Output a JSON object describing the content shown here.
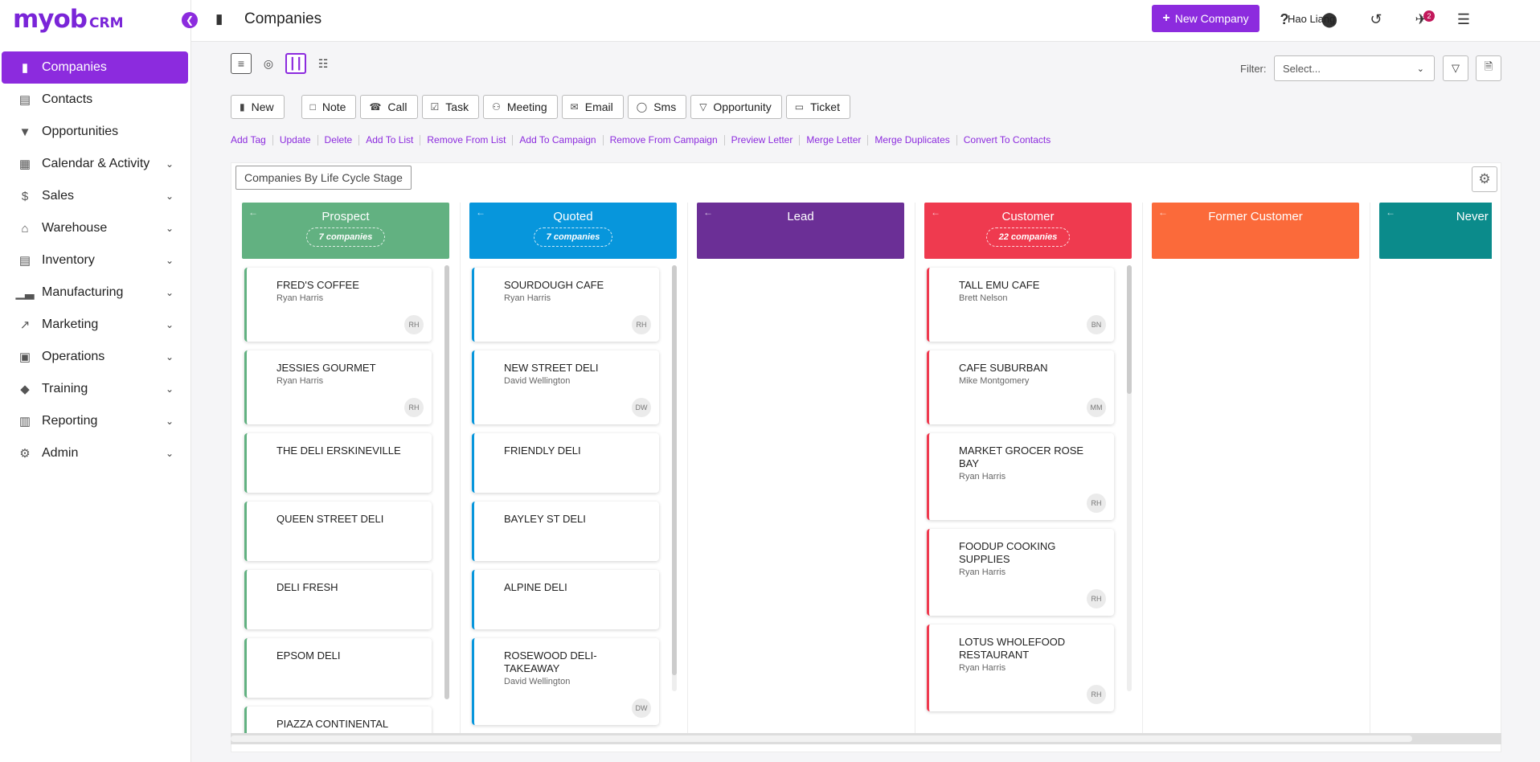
{
  "brand": {
    "logo_main": "myob",
    "logo_sub": "CRM"
  },
  "sidebar": {
    "items": [
      {
        "label": "Companies",
        "icon": "building-icon",
        "active": true
      },
      {
        "label": "Contacts",
        "icon": "contact-card-icon"
      },
      {
        "label": "Opportunities",
        "icon": "funnel-icon"
      },
      {
        "label": "Calendar & Activity",
        "icon": "calendar-icon",
        "expandable": true
      },
      {
        "label": "Sales",
        "icon": "dollar-icon",
        "expandable": true
      },
      {
        "label": "Warehouse",
        "icon": "warehouse-icon",
        "expandable": true
      },
      {
        "label": "Inventory",
        "icon": "clipboard-icon",
        "expandable": true
      },
      {
        "label": "Manufacturing",
        "icon": "factory-icon",
        "expandable": true
      },
      {
        "label": "Marketing",
        "icon": "trend-chart-icon",
        "expandable": true
      },
      {
        "label": "Operations",
        "icon": "operations-icon",
        "expandable": true
      },
      {
        "label": "Training",
        "icon": "graduation-cap-icon",
        "expandable": true
      },
      {
        "label": "Reporting",
        "icon": "report-icon",
        "expandable": true
      },
      {
        "label": "Admin",
        "icon": "gear-icon",
        "expandable": true
      }
    ]
  },
  "header": {
    "title": "Companies",
    "new_button": "New Company",
    "notification_count": "2",
    "user_name": "Hao Liang"
  },
  "filter": {
    "label": "Filter:",
    "placeholder": "Select..."
  },
  "actions": [
    "New",
    "Note",
    "Call",
    "Task",
    "Meeting",
    "Email",
    "Sms",
    "Opportunity",
    "Ticket"
  ],
  "links": [
    "Add Tag",
    "Update",
    "Delete",
    "Add To List",
    "Remove From List",
    "Add To Campaign",
    "Remove From Campaign",
    "Preview Letter",
    "Merge Letter",
    "Merge Duplicates",
    "Convert To Contacts"
  ],
  "board": {
    "title": "Companies By Life Cycle Stage",
    "columns": [
      {
        "name": "Prospect",
        "count": "7 companies",
        "color": "#62b181",
        "cards": [
          {
            "name": "FRED'S COFFEE",
            "owner": "Ryan Harris",
            "initials": "RH"
          },
          {
            "name": "JESSIES GOURMET",
            "owner": "Ryan Harris",
            "initials": "RH"
          },
          {
            "name": "THE DELI ERSKINEVILLE"
          },
          {
            "name": "QUEEN STREET DELI"
          },
          {
            "name": "DELI FRESH"
          },
          {
            "name": "EPSOM DELI"
          },
          {
            "name": "PIAZZA CONTINENTAL"
          }
        ]
      },
      {
        "name": "Quoted",
        "count": "7 companies",
        "color": "#0796dc",
        "cards": [
          {
            "name": "SOURDOUGH CAFE",
            "owner": "Ryan Harris",
            "initials": "RH"
          },
          {
            "name": "NEW STREET DELI",
            "owner": "David Wellington",
            "initials": "DW"
          },
          {
            "name": "FRIENDLY DELI"
          },
          {
            "name": "BAYLEY ST DELI"
          },
          {
            "name": "ALPINE DELI"
          },
          {
            "name": "ROSEWOOD DELI-TAKEAWAY",
            "owner": "David Wellington",
            "initials": "DW"
          }
        ]
      },
      {
        "name": "Lead",
        "count": "",
        "color": "#6b2f96",
        "cards": []
      },
      {
        "name": "Customer",
        "count": "22 companies",
        "color": "#ef3a4f",
        "cards": [
          {
            "name": "TALL EMU CAFE",
            "owner": "Brett Nelson",
            "initials": "BN"
          },
          {
            "name": "CAFE SUBURBAN",
            "owner": "Mike Montgomery",
            "initials": "MM"
          },
          {
            "name": "MARKET GROCER ROSE BAY",
            "owner": "Ryan Harris",
            "initials": "RH"
          },
          {
            "name": "FOODUP COOKING SUPPLIES",
            "owner": "Ryan Harris",
            "initials": "RH"
          },
          {
            "name": "LOTUS WHOLEFOOD RESTAURANT",
            "owner": "Ryan Harris",
            "initials": "RH"
          }
        ]
      },
      {
        "name": "Former Customer",
        "count": "",
        "color": "#fb6a3a",
        "cards": []
      },
      {
        "name": "Never Wo",
        "count": "",
        "color": "#0b8b8b",
        "cards": []
      }
    ]
  }
}
